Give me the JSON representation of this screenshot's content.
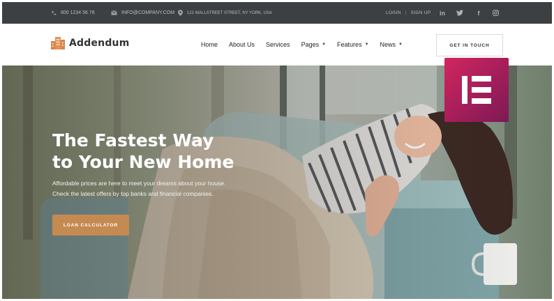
{
  "topbar": {
    "phone": "800 1234 56 78",
    "email": "INFO@COMPANY.COM",
    "address": "121 WALLSTREET STREET, NY YORK, USA",
    "login": "LOGIN",
    "signup": "SIGN UP",
    "social": [
      {
        "icon": "linkedin-icon",
        "glyph": "in"
      },
      {
        "icon": "twitter-icon",
        "glyph": "t"
      },
      {
        "icon": "facebook-icon",
        "glyph": "f"
      },
      {
        "icon": "instagram-icon",
        "glyph": "◎"
      }
    ]
  },
  "header": {
    "logo_text": "Addendum",
    "nav": [
      {
        "label": "Home",
        "dropdown": false
      },
      {
        "label": "About Us",
        "dropdown": false
      },
      {
        "label": "Services",
        "dropdown": false
      },
      {
        "label": "Pages",
        "dropdown": true
      },
      {
        "label": "Features",
        "dropdown": true
      },
      {
        "label": "News",
        "dropdown": true
      }
    ],
    "cta_label": "GET IN TOUCH"
  },
  "hero": {
    "title_line1": "The Fastest Way",
    "title_line2": "to Your New Home",
    "subtitle_line1": "Affordable prices are here to meet your dreams about your house.",
    "subtitle_line2": "Check the latest offers by top banks and financial companies.",
    "button_label": "LOAN CALCULATOR"
  },
  "colors": {
    "topbar_bg": "#3d4043",
    "accent_button": "#c48a52",
    "logo_orange": "#d9844a",
    "elementor_badge": "#c02560"
  },
  "badge": {
    "icon": "elementor-logo-icon"
  }
}
